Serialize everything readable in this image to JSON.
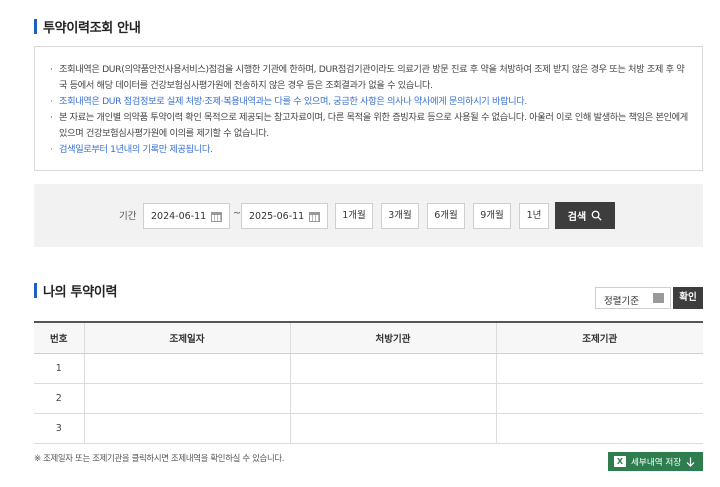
{
  "guide": {
    "title": "투약이력조회 안내",
    "notices": [
      "조회내역은 DUR(의약품안전사용서비스)점검을 시행한 기관에 한하며, DUR점검기관이라도 의료기관 방문 진료 후 약을 처방하여 조제 받지 않은 경우 또는 처방 조제 후 약국 등에서 해당 데이터를 건강보험심사평가원에 전송하지 않은 경우 등은 조회결과가 없을 수 있습니다.",
      "조회내역은 DUR 점검정보로 실제 처방·조제·복용내역과는 다를 수 있으며, 궁금한 사항은 의사나 약사에게 문의하시기 바랍니다.",
      "본 자료는 개인별 의약품 투약이력 확인 목적으로 제공되는 참고자료이며, 다른 목적을 위한 증빙자료 등으로 사용될 수 없습니다. 아울러 이로 인해 발생하는 책임은 본인에게 있으며 건강보험심사평가원에 이의를 제기할 수 없습니다.",
      "검색일로부터 1년내의 기록만 제공됩니다."
    ]
  },
  "search": {
    "period_label": "기간",
    "date_from": "2024-06-11",
    "date_to": "2025-06-11",
    "separator": "~",
    "ranges": [
      "1개월",
      "3개월",
      "6개월",
      "9개월",
      "1년"
    ],
    "search_label": "검색"
  },
  "history": {
    "title": "나의 투약이력",
    "sort_label": "정렬기준",
    "confirm_label": "확인",
    "columns": [
      "번호",
      "조제일자",
      "처방기관",
      "조제기관"
    ],
    "rows": [
      [
        "1",
        "",
        "",
        ""
      ],
      [
        "2",
        "",
        "",
        ""
      ],
      [
        "3",
        "",
        "",
        ""
      ]
    ],
    "footnote": "※ 조제일자 또는 조제기관을 클릭하시면 조제내역을 확인하실 수 있습니다.",
    "excel_label": "세부내역 저장"
  },
  "colors": {
    "accent_blue": "#1e5fc2",
    "notice_blue": "#3a6fd0",
    "dark_button": "#3d3d3d",
    "excel_green": "#2e7d4f"
  },
  "icons": [
    "calendar-icon",
    "search-icon",
    "list-icon",
    "excel-icon",
    "download-icon"
  ]
}
